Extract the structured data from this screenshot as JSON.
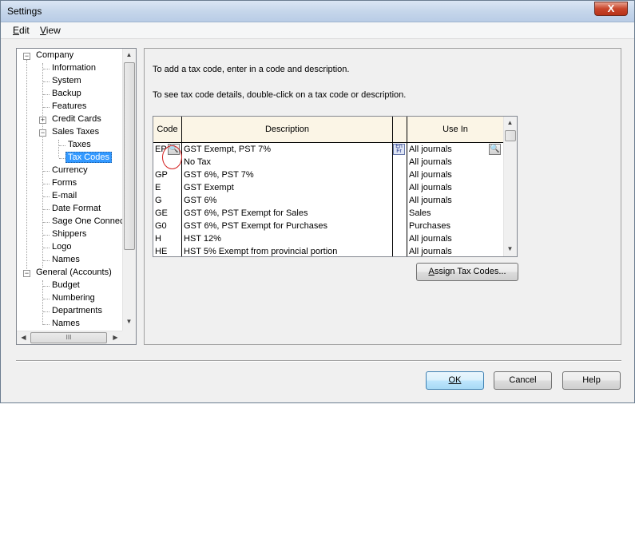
{
  "window": {
    "title": "Settings",
    "close_label": "X"
  },
  "menu": [
    {
      "key": "E",
      "rest": "dit"
    },
    {
      "key": "V",
      "rest": "iew"
    }
  ],
  "tree": {
    "items": [
      {
        "label": "Company",
        "toggle": "−"
      },
      {
        "label": "Information"
      },
      {
        "label": "System"
      },
      {
        "label": "Backup"
      },
      {
        "label": "Features"
      },
      {
        "label": "Credit Cards",
        "toggle": "+"
      },
      {
        "label": "Sales Taxes",
        "toggle": "−"
      },
      {
        "label": "Taxes"
      },
      {
        "label": "Tax Codes",
        "selected": true
      },
      {
        "label": "Currency"
      },
      {
        "label": "Forms"
      },
      {
        "label": "E-mail"
      },
      {
        "label": "Date Format"
      },
      {
        "label": "Sage One Connec"
      },
      {
        "label": "Shippers"
      },
      {
        "label": "Logo"
      },
      {
        "label": "Names"
      },
      {
        "label": "General (Accounts)",
        "toggle": "−"
      },
      {
        "label": "Budget"
      },
      {
        "label": "Numbering"
      },
      {
        "label": "Departments"
      },
      {
        "label": "Names"
      }
    ],
    "hscroll_grip": "III"
  },
  "content": {
    "instruction_1": "To add a tax code, enter in a code and description.",
    "instruction_2": "To see tax code details, double-click on a tax code or description.",
    "table": {
      "headers": {
        "code": "Code",
        "description": "Description",
        "use_in": "Use In"
      },
      "rows": [
        {
          "code": "EP",
          "description": "GST Exempt, PST 7%",
          "use_in": "All journals"
        },
        {
          "code": "",
          "description": "No Tax",
          "use_in": "All journals"
        },
        {
          "code": "GP",
          "description": "GST 6%, PST 7%",
          "use_in": "All journals"
        },
        {
          "code": "E",
          "description": "GST Exempt",
          "use_in": "All journals"
        },
        {
          "code": "G",
          "description": "GST 6%",
          "use_in": "All journals"
        },
        {
          "code": "GE",
          "description": "GST 6%, PST Exempt for Sales",
          "use_in": "Sales"
        },
        {
          "code": "G0",
          "description": "GST 6%, PST Exempt for Purchases",
          "use_in": "Purchases"
        },
        {
          "code": "H",
          "description": "HST 12%",
          "use_in": "All journals"
        },
        {
          "code": "HE",
          "description": "HST 5% Exempt from provincial portion",
          "use_in": "All journals"
        }
      ],
      "lang_icon_text": "En Fr"
    },
    "assign_button": {
      "key": "A",
      "rest": "ssign Tax Codes..."
    }
  },
  "buttons": {
    "ok": "OK",
    "cancel": "Cancel",
    "help": "Help"
  }
}
